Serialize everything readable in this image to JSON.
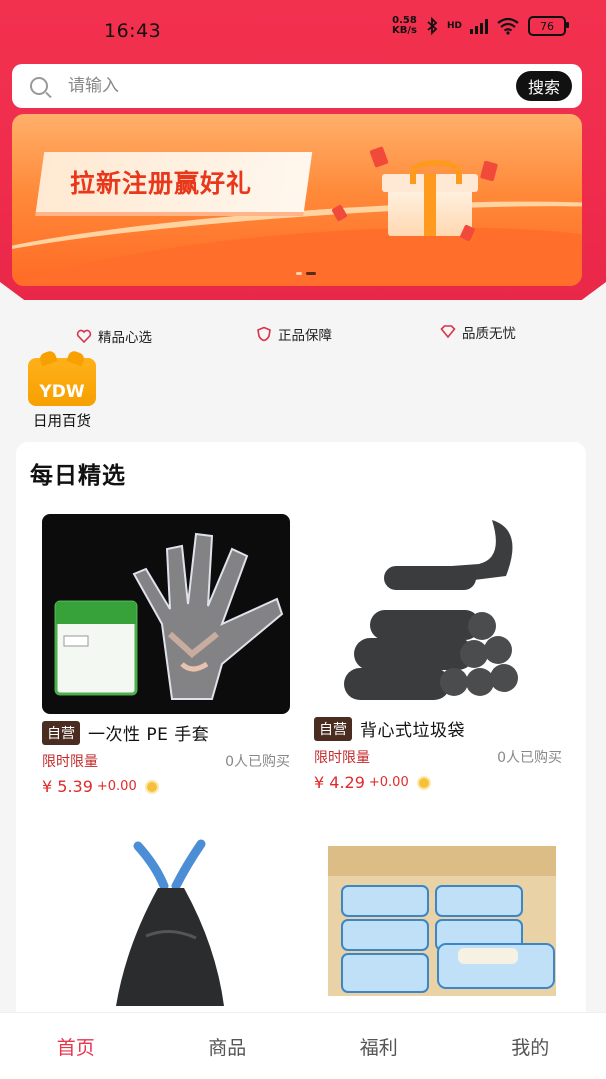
{
  "status": {
    "time": "16:43",
    "speed_value": "0.58",
    "speed_unit": "KB/s",
    "battery": "76",
    "network": "HD"
  },
  "search": {
    "placeholder": "请输入",
    "button": "搜索"
  },
  "banner": {
    "text": "拉新注册赢好礼"
  },
  "badges": [
    {
      "label": "精品心选",
      "icon": "heart-icon"
    },
    {
      "label": "正品保障",
      "icon": "shield-icon"
    },
    {
      "label": "品质无忧",
      "icon": "diamond-icon"
    }
  ],
  "categories": [
    {
      "logo": "YDW",
      "label": "日用百货"
    }
  ],
  "section": {
    "title": "每日精选"
  },
  "products": [
    {
      "tag": "自营",
      "name": "一次性 PE 手套",
      "limit": "限时限量",
      "sold": "0人已购买",
      "price": "¥ 5.39",
      "extra": "+0.00"
    },
    {
      "tag": "自营",
      "name": "背心式垃圾袋",
      "limit": "限时限量",
      "sold": "0人已购买",
      "price": "¥ 4.29",
      "extra": "+0.00"
    }
  ],
  "tabs": [
    {
      "label": "首页",
      "active": true
    },
    {
      "label": "商品",
      "active": false
    },
    {
      "label": "福利",
      "active": false
    },
    {
      "label": "我的",
      "active": false
    }
  ],
  "colors": {
    "brand_red": "#ef2c4c",
    "price_red": "#e12a2a",
    "tag_brown": "#4a2c20",
    "banner_orange": "#ff8a3a"
  }
}
